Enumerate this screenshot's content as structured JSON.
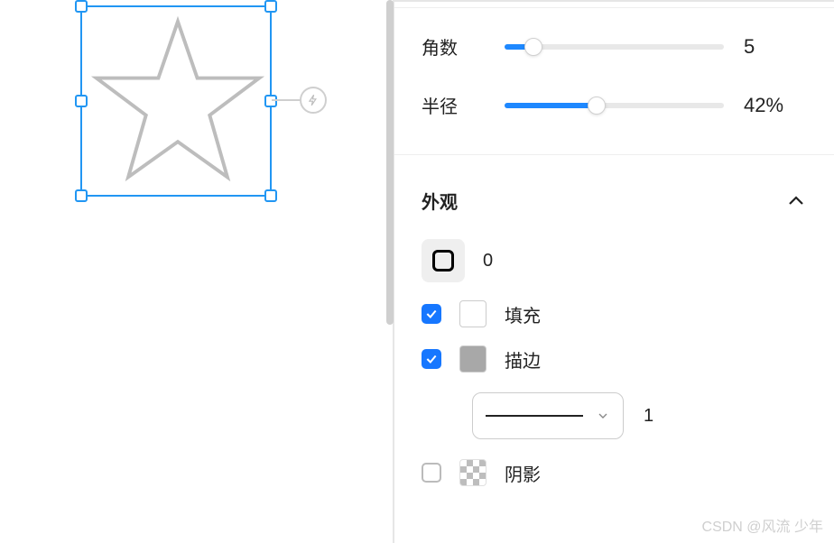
{
  "canvas": {
    "shape": "star",
    "selection_handles": 6
  },
  "sliders": {
    "points": {
      "label": "角数",
      "value": "5",
      "percent": 13
    },
    "radius": {
      "label": "半径",
      "value": "42%",
      "percent": 42
    }
  },
  "appearance": {
    "title": "外观",
    "corner_radius": "0",
    "fill": {
      "checked": true,
      "label": "填充",
      "color": "#ffffff"
    },
    "stroke": {
      "checked": true,
      "label": "描边",
      "color": "#a8a8a8",
      "width": "1"
    },
    "shadow": {
      "checked": false,
      "label": "阴影"
    }
  },
  "watermark": "CSDN @风流 少年"
}
